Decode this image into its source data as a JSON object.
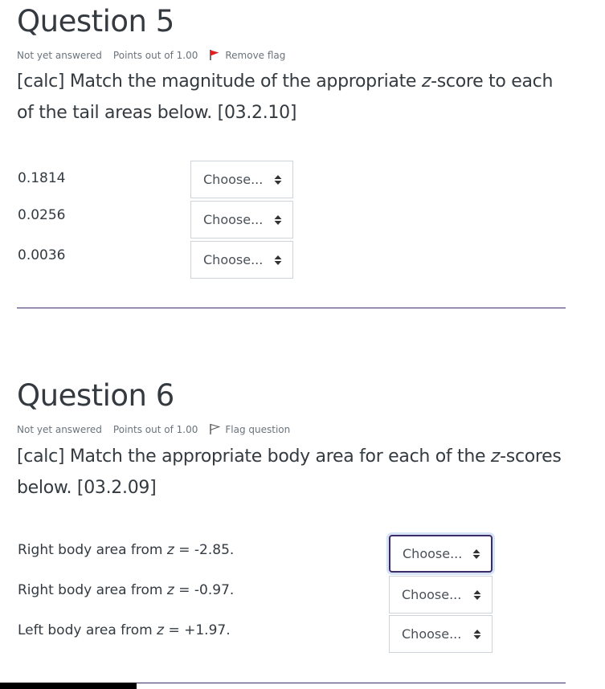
{
  "q5": {
    "title": "Question 5",
    "status": "Not yet answered",
    "points": "Points out of 1.00",
    "flag_label": "Remove flag",
    "text_before": "[calc] Match the magnitude of the appropriate ",
    "text_italic": "z",
    "text_after": "-score to each of the tail areas below. [03.2.10]",
    "rows": [
      {
        "label": "0.1814",
        "select": "Choose..."
      },
      {
        "label": "0.0256",
        "select": "Choose..."
      },
      {
        "label": "0.0036",
        "select": "Choose..."
      }
    ]
  },
  "q6": {
    "title": "Question 6",
    "status": "Not yet answered",
    "points": "Points out of 1.00",
    "flag_label": "Flag question",
    "text_before": "[calc] Match the appropriate body area for each of the ",
    "text_italic": "z",
    "text_after": "-scores below. [03.2.09]",
    "rows": [
      {
        "prefix": "Right body area from ",
        "var": "z",
        "suffix": " = -2.85.",
        "select": "Choose..."
      },
      {
        "prefix": "Right body area from ",
        "var": "z",
        "suffix": " = -0.97.",
        "select": "Choose..."
      },
      {
        "prefix": "Left body area from ",
        "var": "z",
        "suffix": " = +1.97.",
        "select": "Choose..."
      }
    ]
  },
  "colors": {
    "accent": "#3d2a68",
    "flag_red": "#e02020",
    "text": "#333a40",
    "meta": "#6a737b"
  },
  "icons": {
    "flag_filled": "flag-filled-icon",
    "flag_outline": "flag-outline-icon",
    "select_caret": "up-down-caret-icon"
  }
}
